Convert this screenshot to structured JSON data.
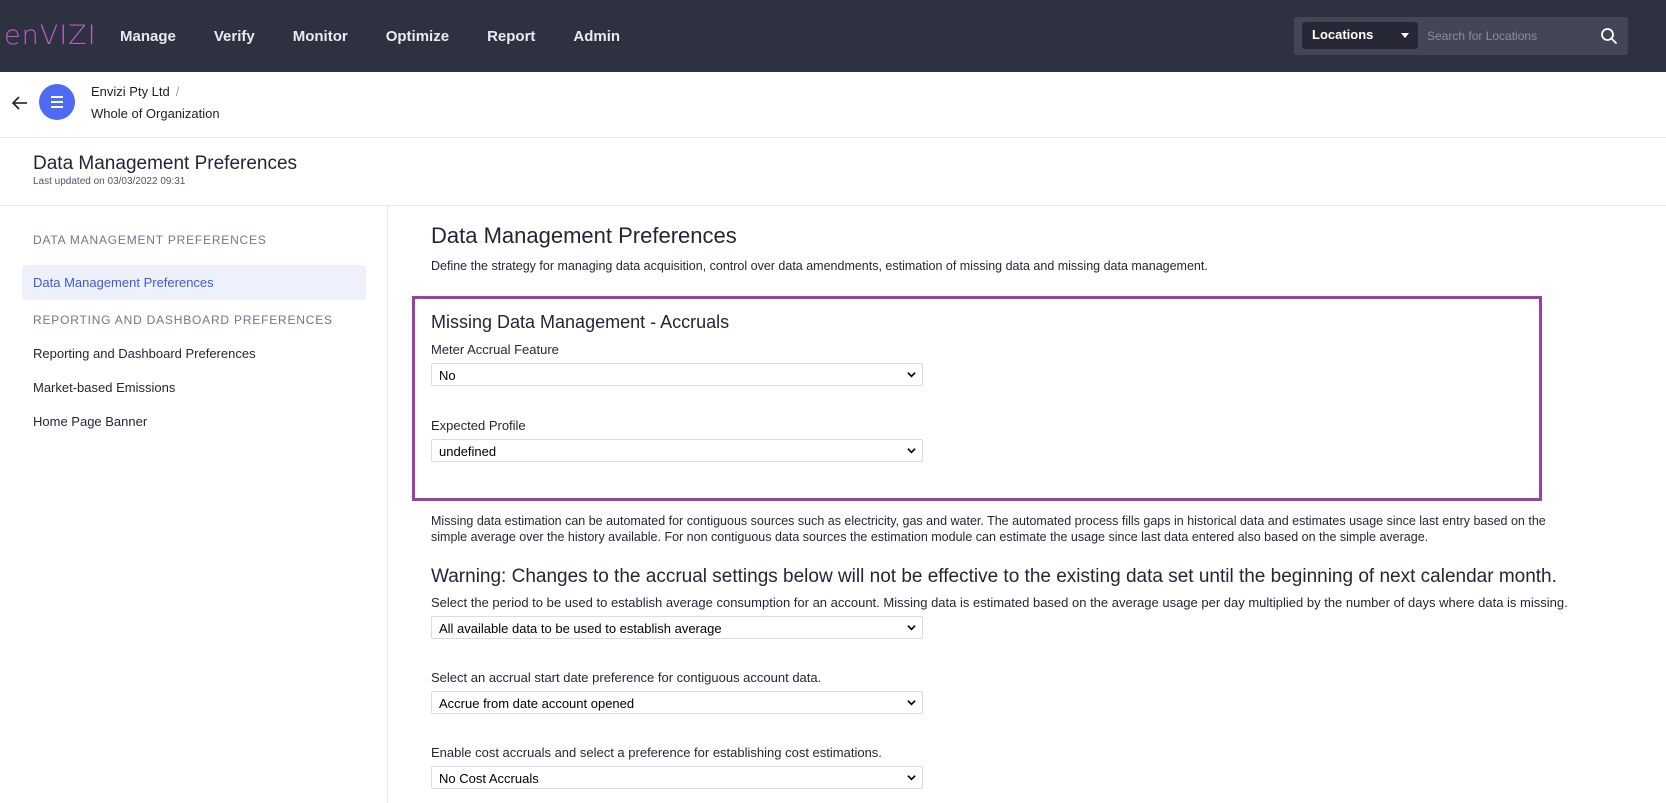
{
  "app": {
    "logo": "enVIZI",
    "brand_color": "#b75fc6",
    "nav": [
      "Manage",
      "Verify",
      "Monitor",
      "Optimize",
      "Report",
      "Admin"
    ],
    "search": {
      "scope_label": "Locations",
      "placeholder": "Search for Locations"
    }
  },
  "breadcrumb": {
    "org": "Envizi Pty Ltd",
    "separator": "/",
    "location": "Whole of Organization"
  },
  "page": {
    "title": "Data Management Preferences",
    "updated": "Last updated on 03/03/2022 09:31"
  },
  "sidebar": {
    "sections": [
      {
        "heading": "DATA MANAGEMENT PREFERENCES",
        "items": [
          "Data Management Preferences"
        ]
      },
      {
        "heading": "REPORTING AND DASHBOARD PREFERENCES",
        "items": [
          "Reporting and Dashboard Preferences",
          "Market-based Emissions",
          "Home Page Banner"
        ]
      }
    ]
  },
  "main": {
    "title": "Data Management Preferences",
    "description": "Define the strategy for managing data acquisition, control over data amendments, estimation of missing data and missing data management.",
    "accruals": {
      "title": "Missing Data Management - Accruals",
      "meter_label": "Meter Accrual Feature",
      "meter_value": "No",
      "profile_label": "Expected Profile",
      "profile_value": "undefined"
    },
    "estimation_text": "Missing data estimation can be automated for contiguous sources such as electricity, gas and water. The automated process fills gaps in historical data and estimates usage since last entry based on the simple average over the history available. For non contiguous data sources the estimation module can estimate the usage since last data entered also based on the simple average.",
    "warning": "Warning: Changes to the accrual settings below will not be effective to the existing data set until the beginning of next calendar month.",
    "period_label": "Select the period to be used to establish average consumption for an account. Missing data is estimated based on the average usage per day multiplied by the number of days where data is missing.",
    "period_value": "All available data to be used to establish average",
    "start_label": "Select an accrual start date preference for contiguous account data.",
    "start_value": "Accrue from date account opened",
    "cost_label": "Enable cost accruals and select a preference for establishing cost estimations.",
    "cost_value": "No Cost Accruals"
  }
}
